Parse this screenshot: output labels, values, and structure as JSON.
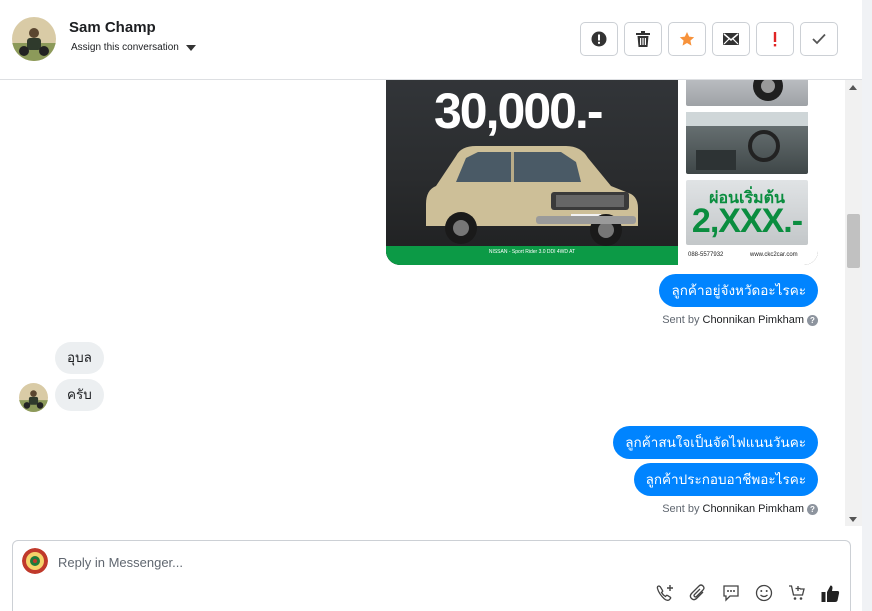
{
  "header": {
    "contact_name": "Sam Champ",
    "assign_label": "Assign this conversation",
    "actions": [
      {
        "name": "spam-report-icon",
        "color": "#333333"
      },
      {
        "name": "trash-icon",
        "color": "#333333"
      },
      {
        "name": "star-icon",
        "color": "#f7923b"
      },
      {
        "name": "envelope-icon",
        "color": "#333333"
      },
      {
        "name": "exclamation-icon",
        "color": "#e02424"
      },
      {
        "name": "check-icon",
        "color": "#555555"
      }
    ]
  },
  "ad": {
    "price_text": "30,000.-",
    "install_label": "ผ่อนเริ่มต้น",
    "install_amount": "2,XXX.-",
    "model_text": "NISSAN - Sport Rider 3.0 DDI 4WD AT",
    "phone": "088-5577932",
    "website": "www.ckc2car.com"
  },
  "messages": {
    "out1": "ลูกค้าอยู่จังหวัดอะไรคะ",
    "sent1_prefix": "Sent by",
    "sent1_agent": "Chonnikan Pimkham",
    "in1": "อุบล",
    "in2": "ครับ",
    "out2": "ลูกค้าสนใจเป็นจัดไฟแนนวันคะ",
    "out3": "ลูกค้าประกอบอาชีพอะไรคะ",
    "sent2_prefix": "Sent by",
    "sent2_agent": "Chonnikan Pimkham"
  },
  "composer": {
    "placeholder": "Reply in Messenger...",
    "tools": [
      "call-plus-icon",
      "attachment-icon",
      "saved-reply-icon",
      "emoji-icon",
      "cart-icon",
      "thumbs-up-icon"
    ]
  },
  "colors": {
    "accent": "#0084ff",
    "incoming_bubble": "#eceff1"
  }
}
